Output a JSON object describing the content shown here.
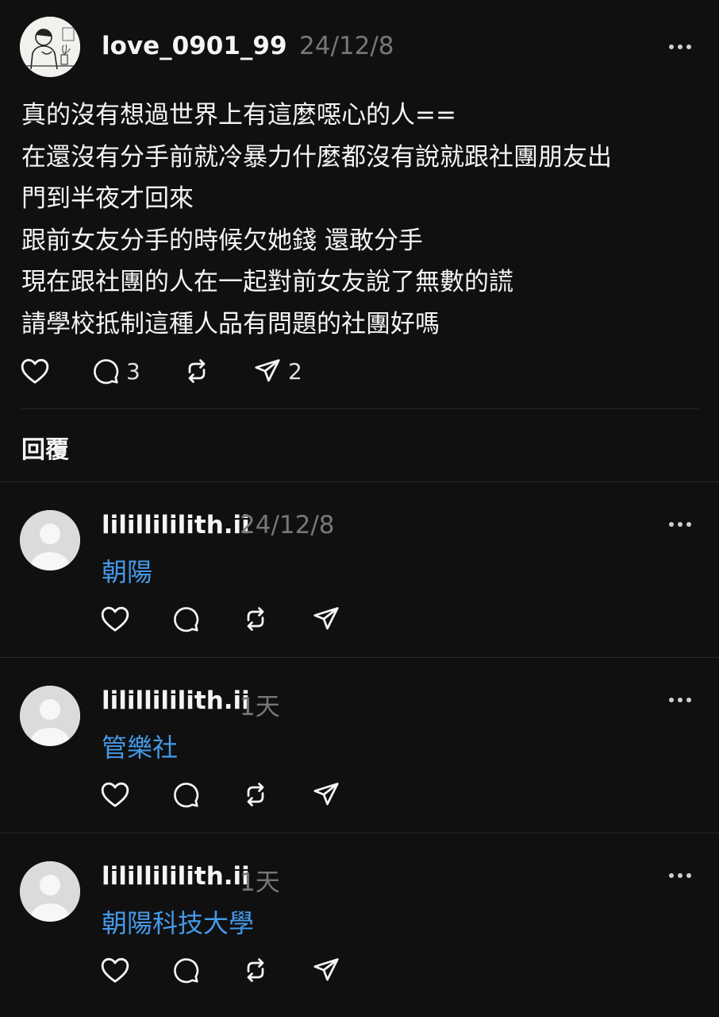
{
  "post": {
    "username": "love_0901_99",
    "timestamp": "24/12/8",
    "text_lines": [
      "真的沒有想過世界上有這麼噁心的人==",
      "在還沒有分手前就冷暴力什麼都沒有說就跟社團朋友出",
      "門到半夜才回來",
      "跟前女友分手的時候欠她錢 還敢分手",
      "現在跟社團的人在一起對前女友說了無數的謊",
      "請學校抵制這種人品有問題的社團好嗎"
    ],
    "actions": {
      "like_icon": "heart-icon",
      "comment_icon": "comment-icon",
      "comment_count": "3",
      "repost_icon": "repost-icon",
      "share_icon": "send-icon",
      "share_count": "2"
    }
  },
  "replies_label": "回覆",
  "replies": [
    {
      "username": "lilillililith.ii",
      "timestamp": "24/12/8",
      "text": "朝陽"
    },
    {
      "username": "lilillililith.ii",
      "timestamp": "1天",
      "text": "管樂社"
    },
    {
      "username": "lilillililith.ii",
      "timestamp": "1天",
      "text": "朝陽科技大學"
    }
  ],
  "colors": {
    "background": "#101010",
    "primary_text": "#f3f5f7",
    "secondary_text": "#777777",
    "link_text": "#4599e8",
    "divider": "#2a2a2a"
  }
}
